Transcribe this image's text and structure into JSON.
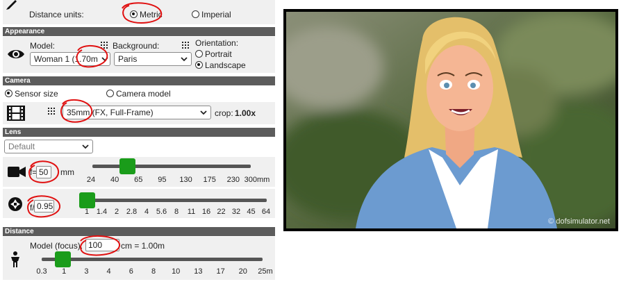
{
  "distance_units": {
    "label": "Distance units:",
    "options": [
      "Metric",
      "Imperial"
    ],
    "selected": "Metric"
  },
  "appearance": {
    "header": "Appearance",
    "model_label": "Model:",
    "model_value": "Woman 1 (1.70m",
    "background_label": "Background:",
    "background_value": "Paris",
    "orientation_label": "Orientation:",
    "orientation_options": [
      "Portrait",
      "Landscape"
    ],
    "orientation_selected": "Landscape"
  },
  "camera": {
    "header": "Camera",
    "mode_options": [
      "Sensor size",
      "Camera model"
    ],
    "mode_selected": "Sensor size",
    "sensor_value": "35mm (FX, Full-Frame)",
    "crop_label": "crop:",
    "crop_value": "1.00x"
  },
  "lens": {
    "header": "Lens",
    "preset_value": "Default",
    "focal_prefix": "f=",
    "focal_value": "50",
    "focal_unit": "mm",
    "focal_ticks": [
      "24",
      "40",
      "65",
      "95",
      "130",
      "175",
      "230",
      "300mm"
    ],
    "focal_slider_fraction": 0.19,
    "aperture_prefix": "f/",
    "aperture_value": "0.95",
    "aperture_ticks": [
      "1",
      "1.4",
      "2",
      "2.8",
      "4",
      "5.6",
      "8",
      "11",
      "16",
      "22",
      "32",
      "45",
      "64"
    ],
    "aperture_slider_fraction": 0.0
  },
  "distance": {
    "header": "Distance",
    "label": "Model (focus):",
    "value": "100",
    "suffix": "cm = 1.00m",
    "ticks": [
      "0.3",
      "1",
      "3",
      "4",
      "6",
      "8",
      "10",
      "13",
      "17",
      "20",
      "25m"
    ],
    "slider_fraction": 0.07
  },
  "photo": {
    "watermark": "© dofsimulator.net"
  },
  "colors": {
    "section_header": "#5c5c5c",
    "slider_thumb": "#1a9c1a",
    "annotation": "#e01010"
  }
}
